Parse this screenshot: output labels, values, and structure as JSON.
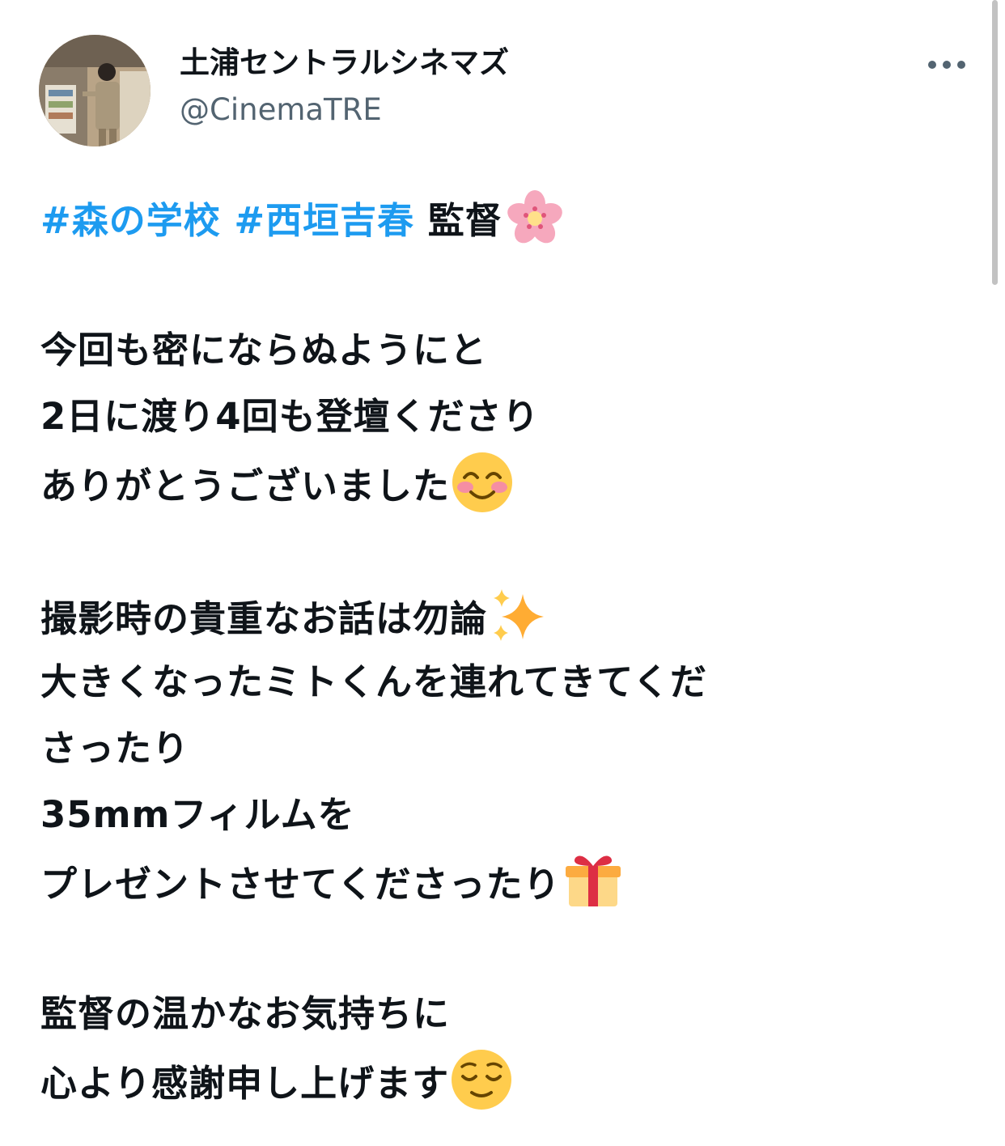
{
  "account": {
    "display_name": "土浦セントラルシネマズ",
    "handle": "@CinemaTRE"
  },
  "menu": {
    "more_icon": "more-horizontal-icon"
  },
  "tweet": {
    "hashtag_1": "#森の学校",
    "hashtag_2": "#西垣吉春",
    "title_suffix": " 監督",
    "line_1": "今回も密にならぬようにと",
    "line_2": "2日に渡り4回も登壇くださり",
    "line_3": "ありがとうございました",
    "line_4": "撮影時の貴重なお話は勿論",
    "line_5": "大きくなったミトくんを連れてきてくだ",
    "line_6": "さったり",
    "line_7": "35mmフィルムを",
    "line_8": "プレゼントさせてくださったり",
    "line_9": "監督の温かなお気持ちに",
    "line_10": "心より感謝申し上げます"
  },
  "emojis": {
    "blossom": "cherry-blossom-icon",
    "smile": "smiling-face-icon",
    "sparkles": "sparkles-icon",
    "gift": "gift-icon",
    "relieved": "relieved-face-icon"
  },
  "colors": {
    "hashtag": "#1d9bf0",
    "text": "#0f1419",
    "secondary": "#536471"
  }
}
